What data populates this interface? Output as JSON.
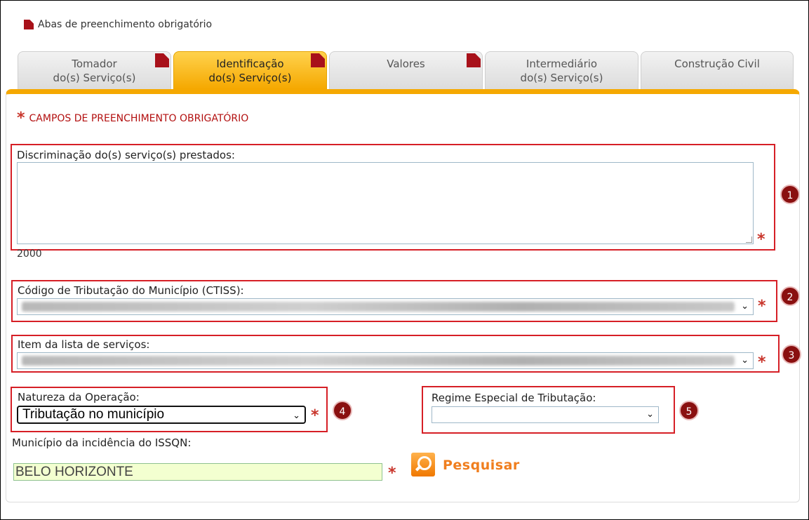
{
  "legend": {
    "text": "Abas de preenchimento obrigatório"
  },
  "tabs": [
    {
      "line1": "Tomador",
      "line2": "do(s) Serviço(s)"
    },
    {
      "line1": "Identificação",
      "line2": "do(s) Serviço(s)"
    },
    {
      "line1": "Valores",
      "line2": ""
    },
    {
      "line1": "Intermediário",
      "line2": "do(s) Serviço(s)"
    },
    {
      "line1": "Construção Civil",
      "line2": ""
    }
  ],
  "form": {
    "required_note": "CAMPOS DE PREENCHIMENTO OBRIGATÓRIO",
    "asterisk": "*",
    "discriminacao_label": "Discriminação do(s) serviço(s) prestados:",
    "char_count": "2000",
    "ctiss_label": "Código de Tributação do Município (CTISS):",
    "item_label": "Item da lista de serviços:",
    "natureza_label": "Natureza da Operação:",
    "natureza_value": "Tributação no município",
    "regime_label": "Regime Especial de Tributação:",
    "municipio_label": "Município da incidência do ISSQN:",
    "municipio_value": "BELO HORIZONTE",
    "search_label": "Pesquisar"
  },
  "badges": [
    "1",
    "2",
    "3",
    "4",
    "5"
  ],
  "icons": {
    "chevron": "⌄",
    "search": "search-icon",
    "flag": "required-flag-icon"
  },
  "colors": {
    "accent": "#f5a800",
    "required": "#b31010",
    "highlight": "#d61f26",
    "badge": "#8a1010",
    "search": "#f07e1e"
  }
}
